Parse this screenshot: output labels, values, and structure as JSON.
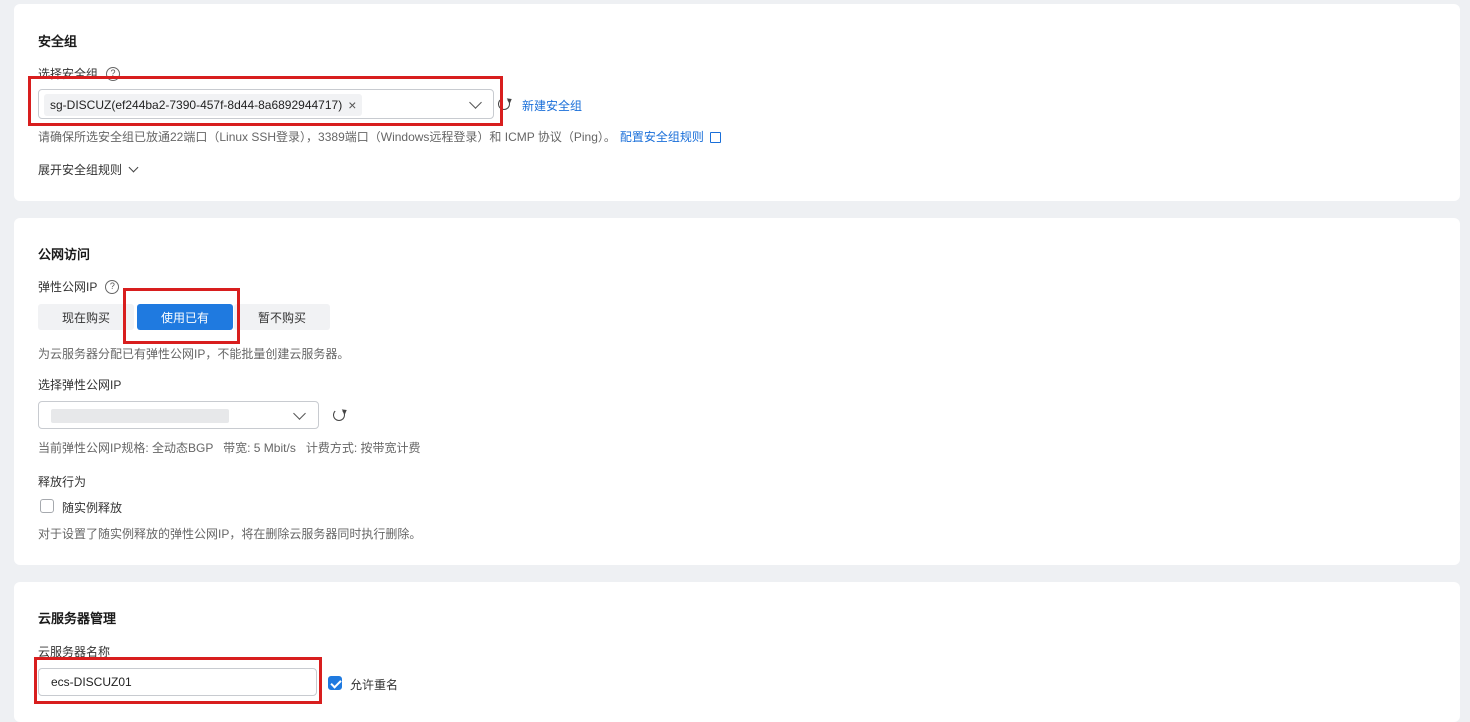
{
  "security_group": {
    "title": "安全组",
    "select_label": "选择安全组",
    "help_glyph": "?",
    "selected_tag": "sg-DISCUZ(ef244ba2-7390-457f-8d44-8a6892944717)",
    "tag_close_glyph": "×",
    "new_link": "新建安全组",
    "hint_text": "请确保所选安全组已放通22端口（Linux SSH登录），3389端口（Windows远程登录）和 ICMP 协议（Ping）。",
    "config_link": "配置安全组规则",
    "expand_rules": "展开安全组规则"
  },
  "public_access": {
    "title": "公网访问",
    "eip_label": "弹性公网IP",
    "help_glyph": "?",
    "options": [
      "现在购买",
      "使用已有",
      "暂不购买"
    ],
    "selected_option": "使用已有",
    "eip_hint": "为云服务器分配已有弹性公网IP，不能批量创建云服务器。",
    "select_eip_label": "选择弹性公网IP",
    "eip_spec": "当前弹性公网IP规格: 全动态BGP   带宽: 5 Mbit/s   计费方式: 按带宽计费",
    "release_label": "释放行为",
    "release_checkbox_label": "随实例释放",
    "release_checked": false,
    "release_hint": "对于设置了随实例释放的弹性公网IP，将在删除云服务器同时执行删除。"
  },
  "server_management": {
    "title": "云服务器管理",
    "name_label": "云服务器名称",
    "name_value": "ecs-DISCUZ01",
    "allow_duplicate_label": "允许重名",
    "allow_duplicate_checked": true
  },
  "colors": {
    "accent": "#1f7ae0",
    "link": "#1a6fd9",
    "highlight_border": "#d81e1e",
    "background": "#eef0f3"
  }
}
